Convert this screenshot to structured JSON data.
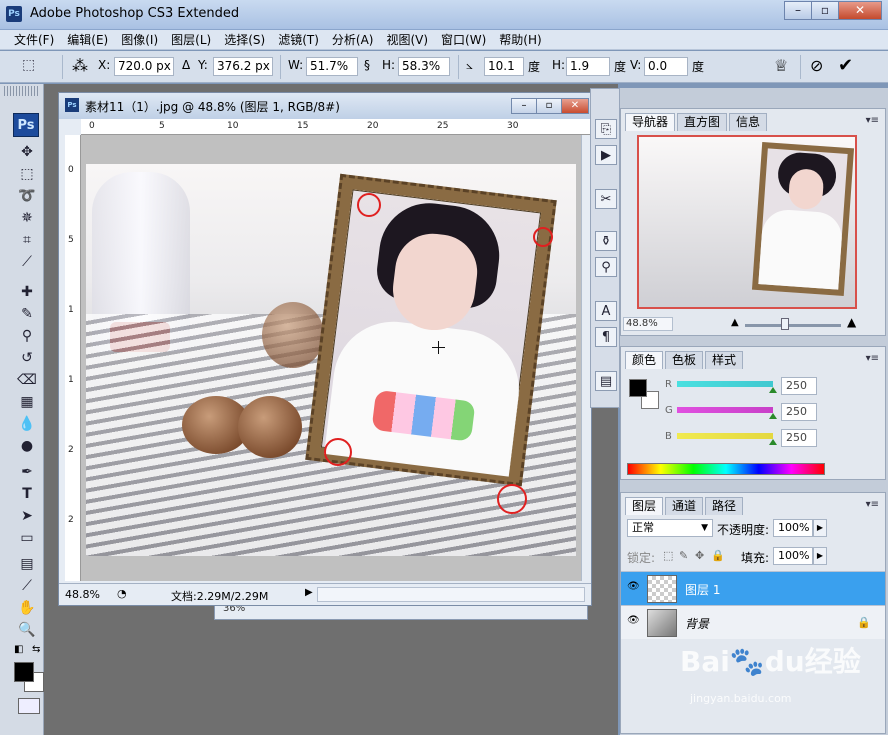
{
  "app": {
    "title": "Adobe Photoshop CS3 Extended",
    "icon": "Ps"
  },
  "menu": [
    "文件(F)",
    "编辑(E)",
    "图像(I)",
    "图层(L)",
    "选择(S)",
    "滤镜(T)",
    "分析(A)",
    "视图(V)",
    "窗口(W)",
    "帮助(H)"
  ],
  "options": {
    "x_label": "X:",
    "x_value": "720.0 px",
    "y_label": "Y:",
    "y_value": "376.2 px",
    "w_label": "W:",
    "w_value": "51.7%",
    "h_label": "H:",
    "h_value": "58.3%",
    "angle_value": "10.1",
    "angle_unit": "度",
    "hskew_label": "H:",
    "hskew_value": "1.9",
    "hskew_unit": "度",
    "vskew_label": "V:",
    "vskew_value": "0.0",
    "vskew_unit": "度"
  },
  "document": {
    "title": "素材11（1）.jpg @ 48.8% (图层 1, RGB/8#)",
    "zoom": "48.8%",
    "doc_size": "文档:2.29M/2.29M",
    "ruler_h": [
      "0",
      "5",
      "10",
      "15",
      "20",
      "25",
      "30"
    ],
    "ruler_v": [
      "0",
      "5",
      "1",
      "1",
      "2",
      "2"
    ]
  },
  "navigator": {
    "tabs": [
      "导航器",
      "直方图",
      "信息"
    ],
    "zoom": "48.8%"
  },
  "color": {
    "tabs": [
      "颜色",
      "色板",
      "样式"
    ],
    "channels": [
      {
        "label": "R",
        "value": "250",
        "color": "#40d8d8"
      },
      {
        "label": "G",
        "value": "250",
        "color": "#d040d0"
      },
      {
        "label": "B",
        "value": "250",
        "color": "#e8e040"
      }
    ],
    "foreground": "#000000",
    "background": "#ffffff"
  },
  "layers": {
    "tabs": [
      "图层",
      "通道",
      "路径"
    ],
    "blend_mode": "正常",
    "opacity_label": "不透明度:",
    "opacity": "100%",
    "lock_label": "锁定:",
    "fill_label": "填充:",
    "fill": "100%",
    "items": [
      {
        "name": "图层 1",
        "selected": true
      },
      {
        "name": "背景",
        "selected": false,
        "locked": true
      }
    ]
  },
  "watermark": {
    "brand": "Bai",
    "brand_mid": "du",
    "brand_tail": "经验",
    "sub": "jingyan.baidu.com"
  }
}
